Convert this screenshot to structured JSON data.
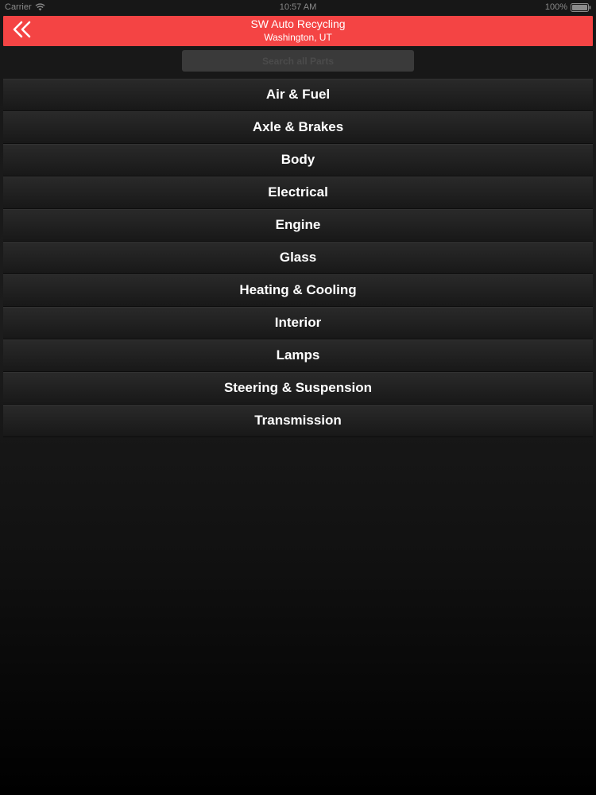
{
  "status_bar": {
    "carrier": "Carrier",
    "time": "10:57 AM",
    "battery": "100%",
    "wifi_icon": "wifi-icon",
    "battery_icon": "battery-icon"
  },
  "header": {
    "title": "SW Auto Recycling",
    "subtitle": "Washington, UT",
    "back_icon": "double-chevron-left-icon",
    "background_color": "#f44444"
  },
  "search": {
    "placeholder": "Search all Parts",
    "value": ""
  },
  "categories": [
    {
      "label": "Air & Fuel"
    },
    {
      "label": "Axle & Brakes"
    },
    {
      "label": "Body"
    },
    {
      "label": "Electrical"
    },
    {
      "label": "Engine"
    },
    {
      "label": "Glass"
    },
    {
      "label": "Heating & Cooling"
    },
    {
      "label": "Interior"
    },
    {
      "label": "Lamps"
    },
    {
      "label": "Steering & Suspension"
    },
    {
      "label": "Transmission"
    }
  ]
}
